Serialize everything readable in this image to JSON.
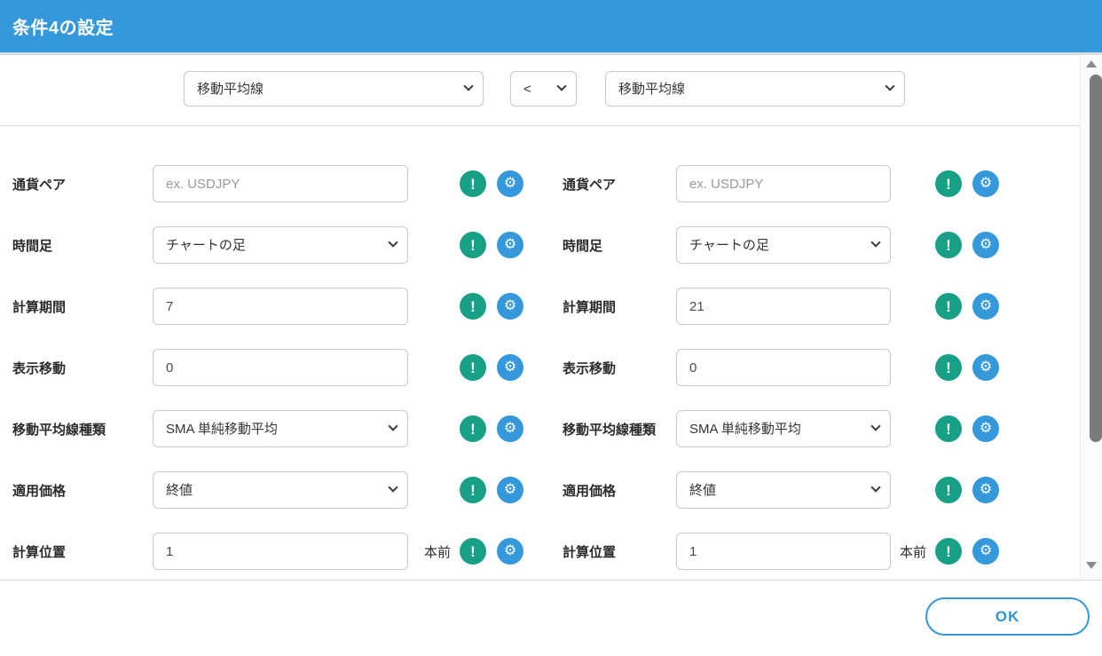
{
  "title_bar": {
    "title": "条件4の設定"
  },
  "header": {
    "indicator_left": "移動平均線",
    "operator": "<",
    "indicator_right": "移動平均線"
  },
  "left": {
    "currency_pair": {
      "label": "通貨ペア",
      "value": "",
      "placeholder": "ex. USDJPY"
    },
    "timeframe": {
      "label": "時間足",
      "value": "チャートの足"
    },
    "period": {
      "label": "計算期間",
      "value": "7"
    },
    "shift": {
      "label": "表示移動",
      "value": "0"
    },
    "ma_type": {
      "label": "移動平均線種類",
      "value": "SMA 単純移動平均"
    },
    "applied_price": {
      "label": "適用価格",
      "value": "終値"
    },
    "calc_position": {
      "label": "計算位置",
      "value": "1",
      "suffix": "本前"
    }
  },
  "right": {
    "currency_pair": {
      "label": "通貨ペア",
      "value": "",
      "placeholder": "ex. USDJPY"
    },
    "timeframe": {
      "label": "時間足",
      "value": "チャートの足"
    },
    "period": {
      "label": "計算期間",
      "value": "21"
    },
    "shift": {
      "label": "表示移動",
      "value": "0"
    },
    "ma_type": {
      "label": "移動平均線種類",
      "value": "SMA 単純移動平均"
    },
    "applied_price": {
      "label": "適用価格",
      "value": "終値"
    },
    "calc_position": {
      "label": "計算位置",
      "value": "1",
      "suffix": "本前"
    }
  },
  "icons": {
    "info": "!",
    "gear": "⚙"
  },
  "footer": {
    "ok_label": "OK"
  },
  "colors": {
    "titlebar_blue": "#3498db",
    "info_green": "#17a085",
    "gear_blue": "#3498db",
    "ok_text_blue": "#2e96d8"
  }
}
